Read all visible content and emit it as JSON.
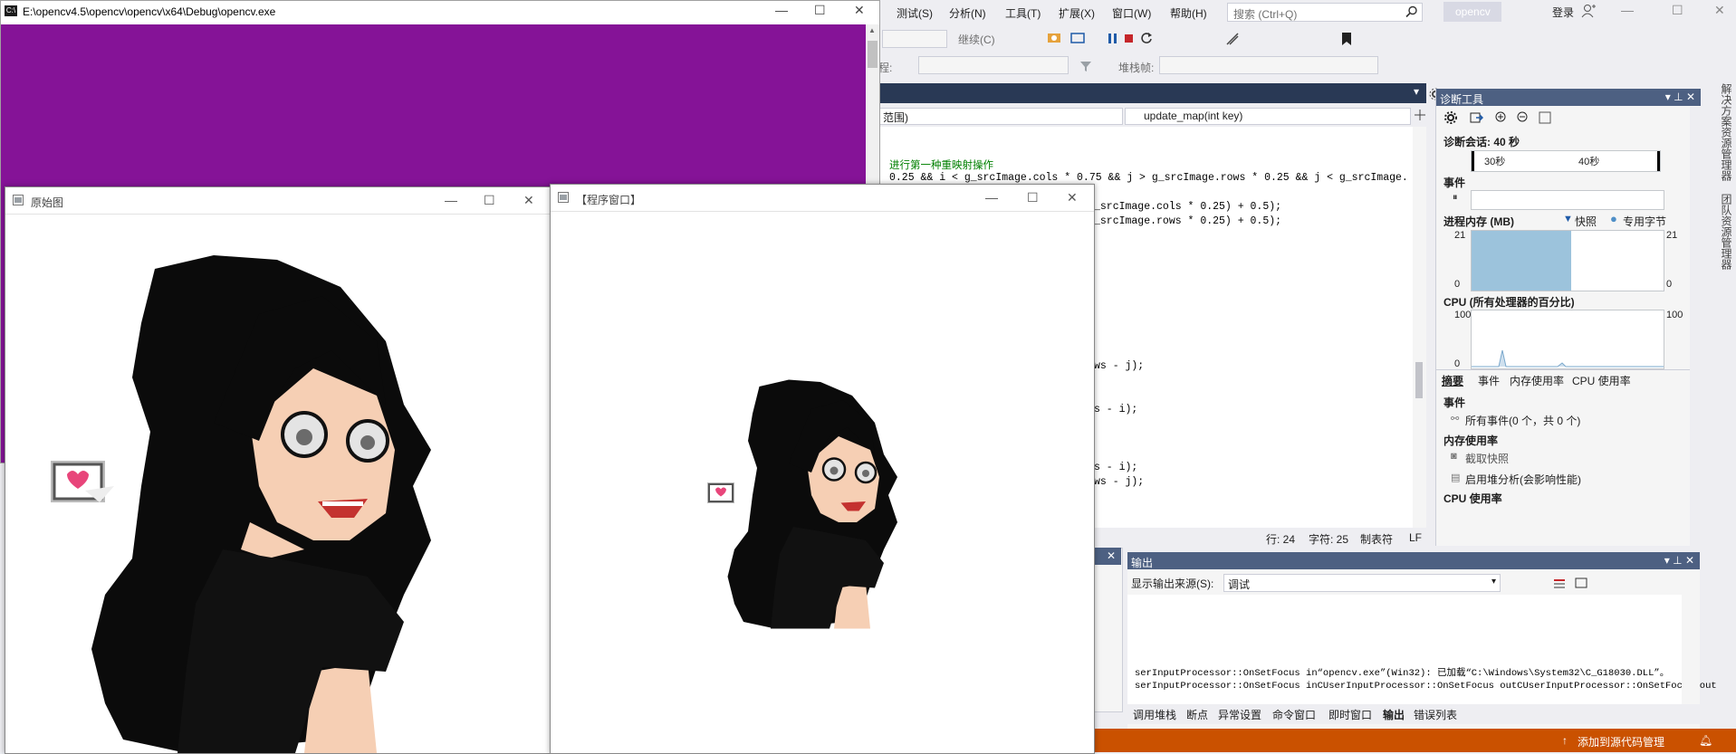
{
  "console": {
    "title": "E:\\opencv4.5\\opencv\\opencv\\x64\\Debug\\opencv.exe",
    "bg_color": "#851397"
  },
  "vs": {
    "menu": [
      "测试(S)",
      "分析(N)",
      "工具(T)",
      "扩展(X)",
      "窗口(W)",
      "帮助(H)"
    ],
    "search_placeholder": "搜索 (Ctrl+Q)",
    "project_name": "opencv",
    "login_label": "登录",
    "toolbar": {
      "continue_label": "继续(C)",
      "process_label": "程:",
      "stackframe_label": "堆栈帧:"
    },
    "nav": {
      "scope_label": "范围)",
      "function_label": "update_map(int key)"
    },
    "code": {
      "line1": "进行第一种重映射操作",
      "line2": "0.25 && i < g_srcImage.cols * 0.75 && j > g_srcImage.rows * 0.25 && j < g_srcImage.",
      "line3": "_srcImage.cols * 0.25) + 0.5);",
      "line4": "_srcImage.rows * 0.25) + 0.5);",
      "line5": "ws - j);",
      "line6": "s - i);",
      "line7": "s - i);",
      "line8": "ws - j);"
    },
    "editor_status": {
      "line": "行: 24",
      "char": "字符: 25",
      "tab": "制表符",
      "eol": "LF"
    },
    "diag": {
      "title": "诊断工具",
      "session": "诊断会话: 40 秒",
      "tick_30": "30秒",
      "tick_40": "40秒",
      "events_label": "事件",
      "mem_label": "进程内存 (MB)",
      "snapshot_label": "快照",
      "private_bytes_label": "专用字节",
      "mem_max": "21",
      "mem_min": "0",
      "cpu_label": "CPU (所有处理器的百分比)",
      "cpu_max": "100",
      "cpu_min": "0",
      "tabs": [
        "摘要",
        "事件",
        "内存使用率",
        "CPU 使用率"
      ],
      "sec_events": "事件",
      "all_events": "所有事件(0 个，共 0 个)",
      "sec_mem": "内存使用率",
      "take_snapshot": "截取快照",
      "heap_analysis": "启用堆分析(会影响性能)",
      "sec_cpu": "CPU 使用率",
      "mem_fill_fraction": 0.52
    },
    "output": {
      "title": "输出",
      "source_label": "显示输出来源(S):",
      "source_value": "调试",
      "line1": "serInputProcessor::OnSetFocus in“opencv.exe”(Win32): 已加载“C:\\Windows\\System32\\C_G18030.DLL”。",
      "line2": "serInputProcessor::OnSetFocus inCUserInputProcessor::OnSetFocus outCUserInputProcessor::OnSetFocus out"
    },
    "bottom_tabs": [
      "调用堆栈",
      "断点",
      "异常设置",
      "命令窗口",
      "即时窗口",
      "输出",
      "错误列表"
    ],
    "statusbar_label": "添加到源代码管理",
    "right_sidebar": [
      "解决方案资源管理器",
      "团队资源管理器"
    ]
  },
  "windows": {
    "original": {
      "title": "原始图"
    },
    "program": {
      "title": "【程序窗口】"
    }
  },
  "colors": {
    "vs_blue": "#293955",
    "panel_title": "#4d6082",
    "status_orange": "#ca5100",
    "console_purple": "#851397"
  }
}
